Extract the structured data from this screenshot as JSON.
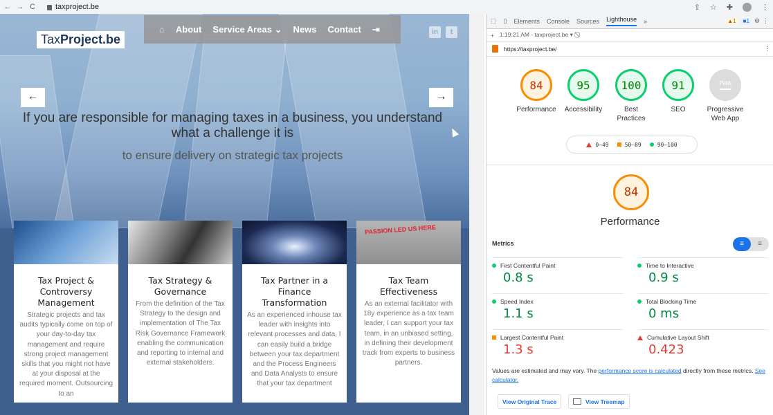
{
  "browser": {
    "url": "taxproject.be"
  },
  "site": {
    "logo_regular": "Tax",
    "logo_bold": "Project.be",
    "nav": [
      "About",
      "Service Areas",
      "News",
      "Contact"
    ],
    "social": [
      "in",
      "t"
    ],
    "headline": "If you are responsible for managing taxes in a business, you understand what a challenge it is",
    "subline": "to ensure delivery on strategic tax projects",
    "cards": [
      {
        "title": "Tax Project & Controversy Management",
        "body": "Strategic projects and tax audits typically come on top of your day-to-day tax management and require strong project management skills that you might not have at your disposal at the required moment. Outsourcing to an"
      },
      {
        "title": "Tax Strategy & Governance",
        "body": "From the definition of the Tax Strategy to the design and implementation of The Tax Risk Governance Framework enabling the communication and reporting to internal and external stakeholders."
      },
      {
        "title": "Tax Partner in a Finance Transformation",
        "body": "As an experienced inhouse tax leader with insights into relevant processes and data, I can easily build a bridge between your tax department and the Process Engineers and Data Analysts to ensure that your tax department"
      },
      {
        "title": "Tax Team Effectiveness",
        "body": "As an external facilitator with 18y experience as a tax team leader, I can support your tax team, in an unbiased setting, in defining their development track from experts to business partners."
      }
    ],
    "card_image_text": "PASSION LED US HERE"
  },
  "devtools": {
    "tabs": [
      "Elements",
      "Console",
      "Sources",
      "Lighthouse"
    ],
    "active_tab": "Lighthouse",
    "more": "»",
    "warnings": "1",
    "messages": "1",
    "report_time": "1:19:21 AM - taxproject.be",
    "audited_url": "https://taxproject.be/",
    "gauges": [
      {
        "score": "84",
        "label": "Performance",
        "color": "#fa8c00"
      },
      {
        "score": "95",
        "label": "Accessibility",
        "color": "#0cce6b"
      },
      {
        "score": "100",
        "label": "Best Practices",
        "color": "#0cce6b"
      },
      {
        "score": "91",
        "label": "SEO",
        "color": "#0cce6b"
      }
    ],
    "pwa": {
      "badge": "PWA",
      "label": "Progressive Web App"
    },
    "legend": [
      "0–49",
      "50–89",
      "90–100"
    ],
    "performance_score": "84",
    "performance_title": "Performance",
    "metrics_heading": "Metrics",
    "metrics": [
      {
        "name": "First Contentful Paint",
        "value": "0.8 s",
        "status": "pass"
      },
      {
        "name": "Time to Interactive",
        "value": "0.9 s",
        "status": "pass"
      },
      {
        "name": "Speed Index",
        "value": "1.1 s",
        "status": "pass"
      },
      {
        "name": "Total Blocking Time",
        "value": "0 ms",
        "status": "pass"
      },
      {
        "name": "Largest Contentful Paint",
        "value": "1.3 s",
        "status": "average"
      },
      {
        "name": "Cumulative Layout Shift",
        "value": "0.423",
        "status": "fail"
      }
    ],
    "note_prefix": "Values are estimated and may vary. The",
    "note_link": "performance score is calculated",
    "note_middle": "directly from these metrics.",
    "note_link2": "See calculator.",
    "btn_trace": "View Original Trace",
    "btn_treemap": "View Treemap",
    "colors": {
      "pass": "#0cce6b",
      "average": "#fa8c00",
      "fail": "#e53935",
      "accent": "#1a73e8"
    }
  }
}
